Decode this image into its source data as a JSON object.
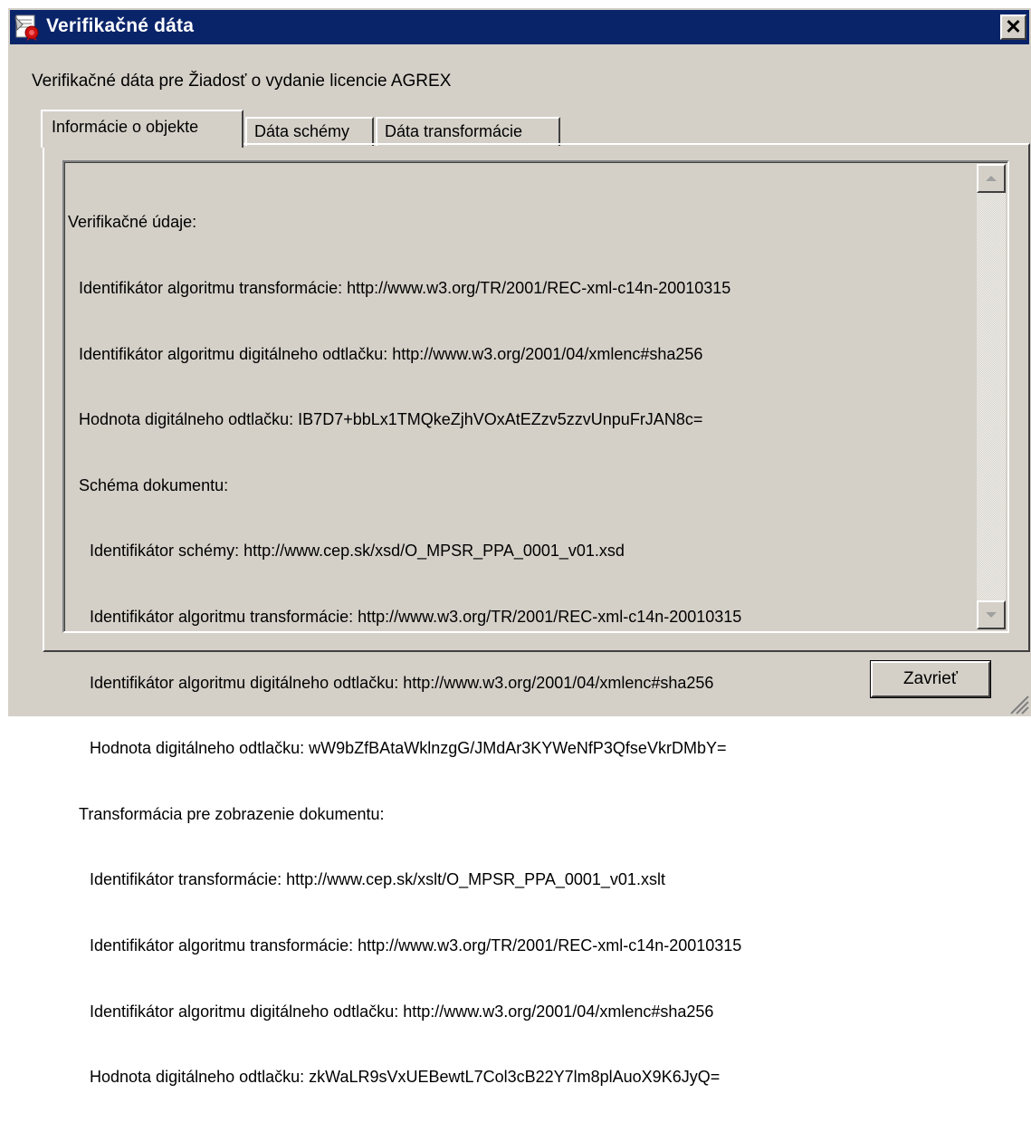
{
  "window": {
    "title": "Verifikačné dáta",
    "close_glyph": "✕",
    "icon": "certificate-seal-icon"
  },
  "subtitle": "Verifikačné dáta pre Žiadosť o vydanie licencie AGREX",
  "tabs": [
    {
      "label": "Informácie o objekte",
      "active": true
    },
    {
      "label": "Dáta schémy",
      "active": false
    },
    {
      "label": "Dáta transformácie",
      "active": false
    }
  ],
  "content": {
    "heading": "Verifikačné údaje:",
    "l1": "Identifikátor algoritmu transformácie: http://www.w3.org/TR/2001/REC-xml-c14n-20010315",
    "l2": "Identifikátor algoritmu digitálneho odtlačku: http://www.w3.org/2001/04/xmlenc#sha256",
    "l3": "Hodnota digitálneho odtlačku: IB7D7+bbLx1TMQkeZjhVOxAtEZzv5zzvUnpuFrJAN8c=",
    "l4": "Schéma dokumentu:",
    "l5": "Identifikátor schémy: http://www.cep.sk/xsd/O_MPSR_PPA_0001_v01.xsd",
    "l6": "Identifikátor algoritmu transformácie: http://www.w3.org/TR/2001/REC-xml-c14n-20010315",
    "l7": "Identifikátor algoritmu digitálneho odtlačku: http://www.w3.org/2001/04/xmlenc#sha256",
    "l8": "Hodnota digitálneho odtlačku: wW9bZfBAtaWklnzgG/JMdAr3KYWeNfP3QfseVkrDMbY=",
    "l9": "Transformácia pre zobrazenie dokumentu:",
    "l10": "Identifikátor transformácie: http://www.cep.sk/xslt/O_MPSR_PPA_0001_v01.xslt",
    "l11": "Identifikátor algoritmu transformácie: http://www.w3.org/TR/2001/REC-xml-c14n-20010315",
    "l12": "Identifikátor algoritmu digitálneho odtlačku: http://www.w3.org/2001/04/xmlenc#sha256",
    "l13": "Hodnota digitálneho odtlačku: zkWaLR9sVxUEBewtL7Col3cB22Y7lm8plAuoX9K6JyQ="
  },
  "buttons": {
    "close_label": "Zavrieť"
  },
  "colors": {
    "titlebar": "#0a246a",
    "face": "#d4d0c8"
  }
}
